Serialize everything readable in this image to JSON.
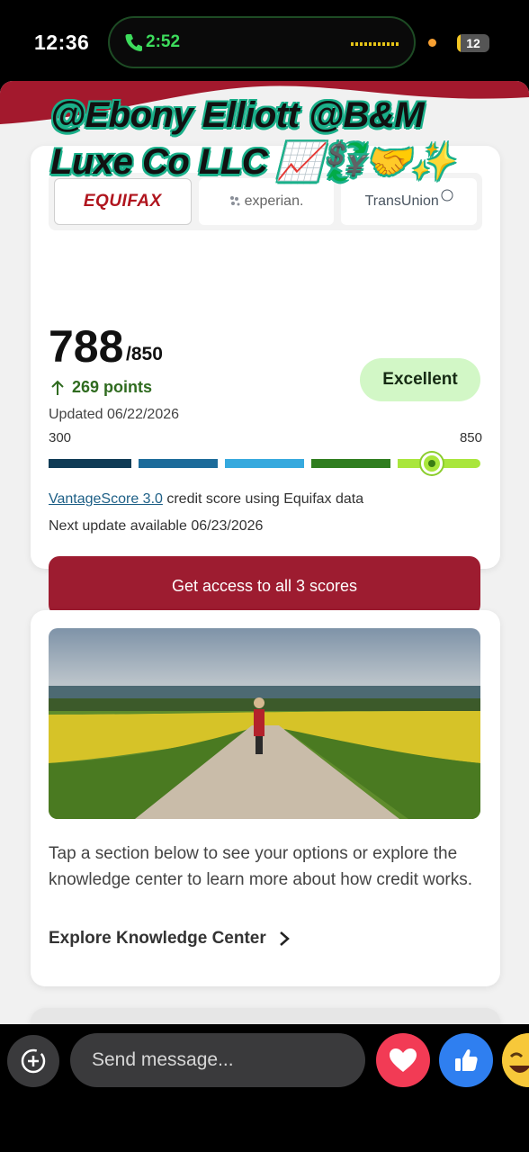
{
  "status_bar": {
    "time": "12:36",
    "call_duration": "2:52",
    "battery_level": "12",
    "battery_fraction": 0.12
  },
  "overlay": {
    "line1": "@Ebony Elliott @B&M",
    "line2": "Luxe Co LLC 📈💱🤝✨"
  },
  "score_card": {
    "bureaus": [
      "EQUIFAX",
      "experian.",
      "TransUnion"
    ],
    "active_bureau": "EQUIFAX",
    "score": "788",
    "score_max": "/850",
    "change": "269 points",
    "rating": "Excellent",
    "updated": "Updated 06/22/2026",
    "range_min": "300",
    "range_max": "850",
    "score_value": 788,
    "score_min": 300,
    "score_max_value": 850,
    "model_link": "VantageScore 3.0",
    "model_suffix": " credit score using Equifax data",
    "next_update": "Next update available 06/23/2026",
    "cta_label": "Get access to all 3 scores"
  },
  "knowledge_card": {
    "description": "Tap a section below to see your options or explore the knowledge center to learn more about how credit works.",
    "explore_label": "Explore Knowledge Center"
  },
  "message_bar": {
    "placeholder": "Send message..."
  },
  "colors": {
    "brand_red": "#9d1c30",
    "excellent_green": "#d2f7c6",
    "bar_segments": [
      "#0f3b55",
      "#1c6b9a",
      "#36a9de",
      "#2f7d1f",
      "#a9e63c"
    ]
  }
}
